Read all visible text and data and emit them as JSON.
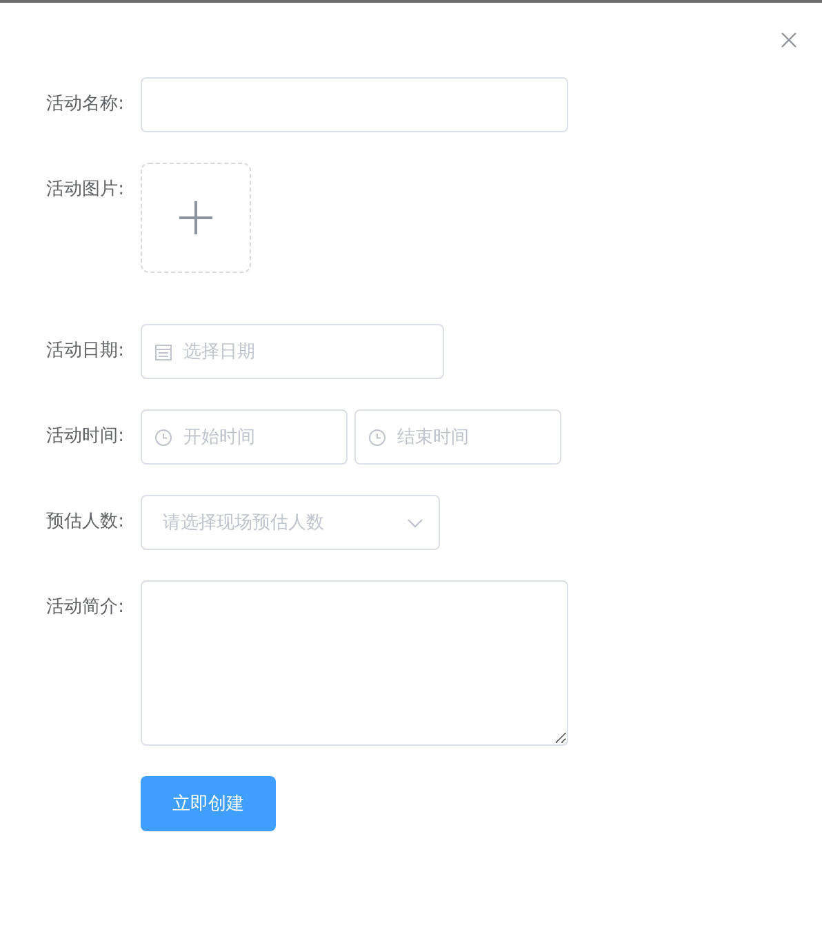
{
  "form": {
    "fields": [
      {
        "kind": "text",
        "label": "活动名称:"
      },
      {
        "kind": "upload",
        "label": "活动图片:"
      },
      {
        "kind": "date",
        "label": "活动日期:",
        "placeholder": "选择日期"
      },
      {
        "kind": "time-range",
        "label": "活动时间:",
        "placeholders": [
          "开始时间",
          "结束时间"
        ]
      },
      {
        "kind": "select",
        "label": "预估人数:",
        "placeholder": "请选择现场预估人数"
      },
      {
        "kind": "textarea",
        "label": "活动简介:"
      }
    ],
    "submit": "立即创建"
  }
}
